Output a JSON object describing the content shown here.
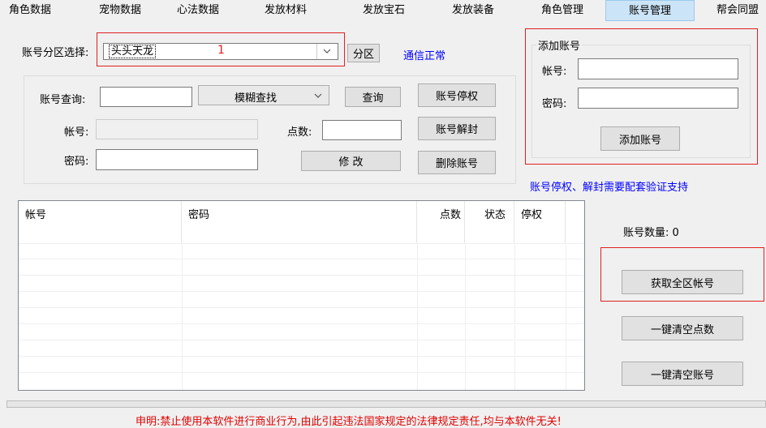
{
  "tabs": [
    {
      "label": "角色数据"
    },
    {
      "label": "宠物数据"
    },
    {
      "label": "心法数据"
    },
    {
      "label": "发放材料"
    },
    {
      "label": "发放宝石"
    },
    {
      "label": "发放装备"
    },
    {
      "label": "角色管理"
    },
    {
      "label": "账号管理"
    },
    {
      "label": "帮会同盟"
    }
  ],
  "region": {
    "label": "账号分区选择:",
    "selected": "头头天龙",
    "marker": "1",
    "button": "分区",
    "status": "通信正常"
  },
  "query": {
    "search_label": "账号查询:",
    "search_value": "",
    "mode_selected": "模糊查找",
    "query_button": "查询",
    "suspend_button": "账号停权",
    "account_label": "帐号:",
    "points_label": "点数:",
    "unlock_button": "账号解封",
    "password_label": "密码:",
    "modify_button": "修  改",
    "delete_button": "删除账号"
  },
  "add_account": {
    "group_title": "添加账号",
    "account_label": "帐号:",
    "password_label": "密码:",
    "add_button": "添加账号"
  },
  "note": "账号停权、解封需要配套验证支持",
  "table": {
    "columns": [
      "帐号",
      "密码",
      "点数",
      "状态",
      "停权"
    ]
  },
  "side": {
    "count_label": "账号数量: 0",
    "fetch_all_button": "获取全区帐号",
    "clear_points_button": "一键清空点数",
    "clear_accounts_button": "一键清空账号"
  },
  "footer": "申明:禁止使用本软件进行商业行为,由此引起违法国家规定的法律规定责任,均与本软件无关!",
  "colors": {
    "status_blue": "#0000ff",
    "footer_red": "#e00000",
    "highlight_red": "#e02020",
    "active_tab": "#cce4f7"
  }
}
